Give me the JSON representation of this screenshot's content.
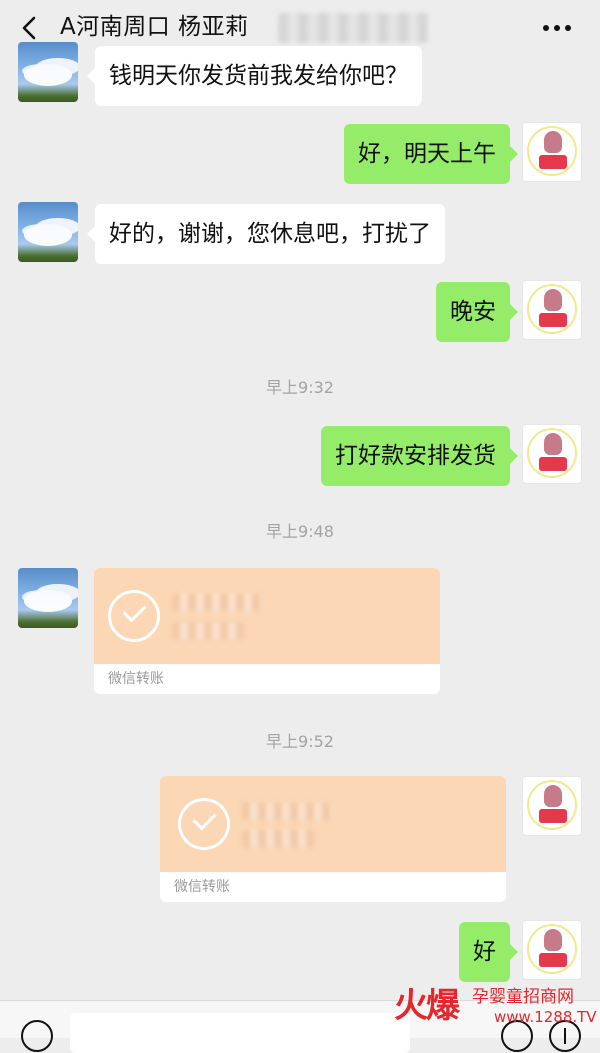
{
  "header": {
    "title": "A河南周口  杨亚莉"
  },
  "messages": [
    {
      "side": "left",
      "type": "text",
      "text": "钱明天你发货前我发给你吧？"
    },
    {
      "side": "right",
      "type": "text",
      "text": "好，明天上午"
    },
    {
      "side": "left",
      "type": "text",
      "text": "好的，谢谢，您休息吧，打扰了"
    },
    {
      "side": "right",
      "type": "text",
      "text": "晚安"
    },
    {
      "type": "time",
      "text": "早上9:32"
    },
    {
      "side": "right",
      "type": "text",
      "text": "打好款安排发货"
    },
    {
      "type": "time",
      "text": "早上9:48"
    },
    {
      "side": "left",
      "type": "transfer",
      "label": "微信转账"
    },
    {
      "type": "time",
      "text": "早上9:52"
    },
    {
      "side": "right",
      "type": "transfer",
      "label": "微信转账"
    },
    {
      "side": "right",
      "type": "text",
      "text": "好"
    }
  ],
  "watermark": {
    "logo": "火爆",
    "line1": "孕婴童招商网",
    "line2": "www.1288.TV"
  },
  "colors": {
    "background": "#ededed",
    "sent_bubble": "#95ec69",
    "received_bubble": "#ffffff",
    "transfer": "#fbd7b6",
    "watermark": "#e2282d"
  },
  "icons": [
    "back-icon",
    "more-icon",
    "check-circle-icon",
    "voice-icon",
    "emoji-icon",
    "plus-icon"
  ]
}
